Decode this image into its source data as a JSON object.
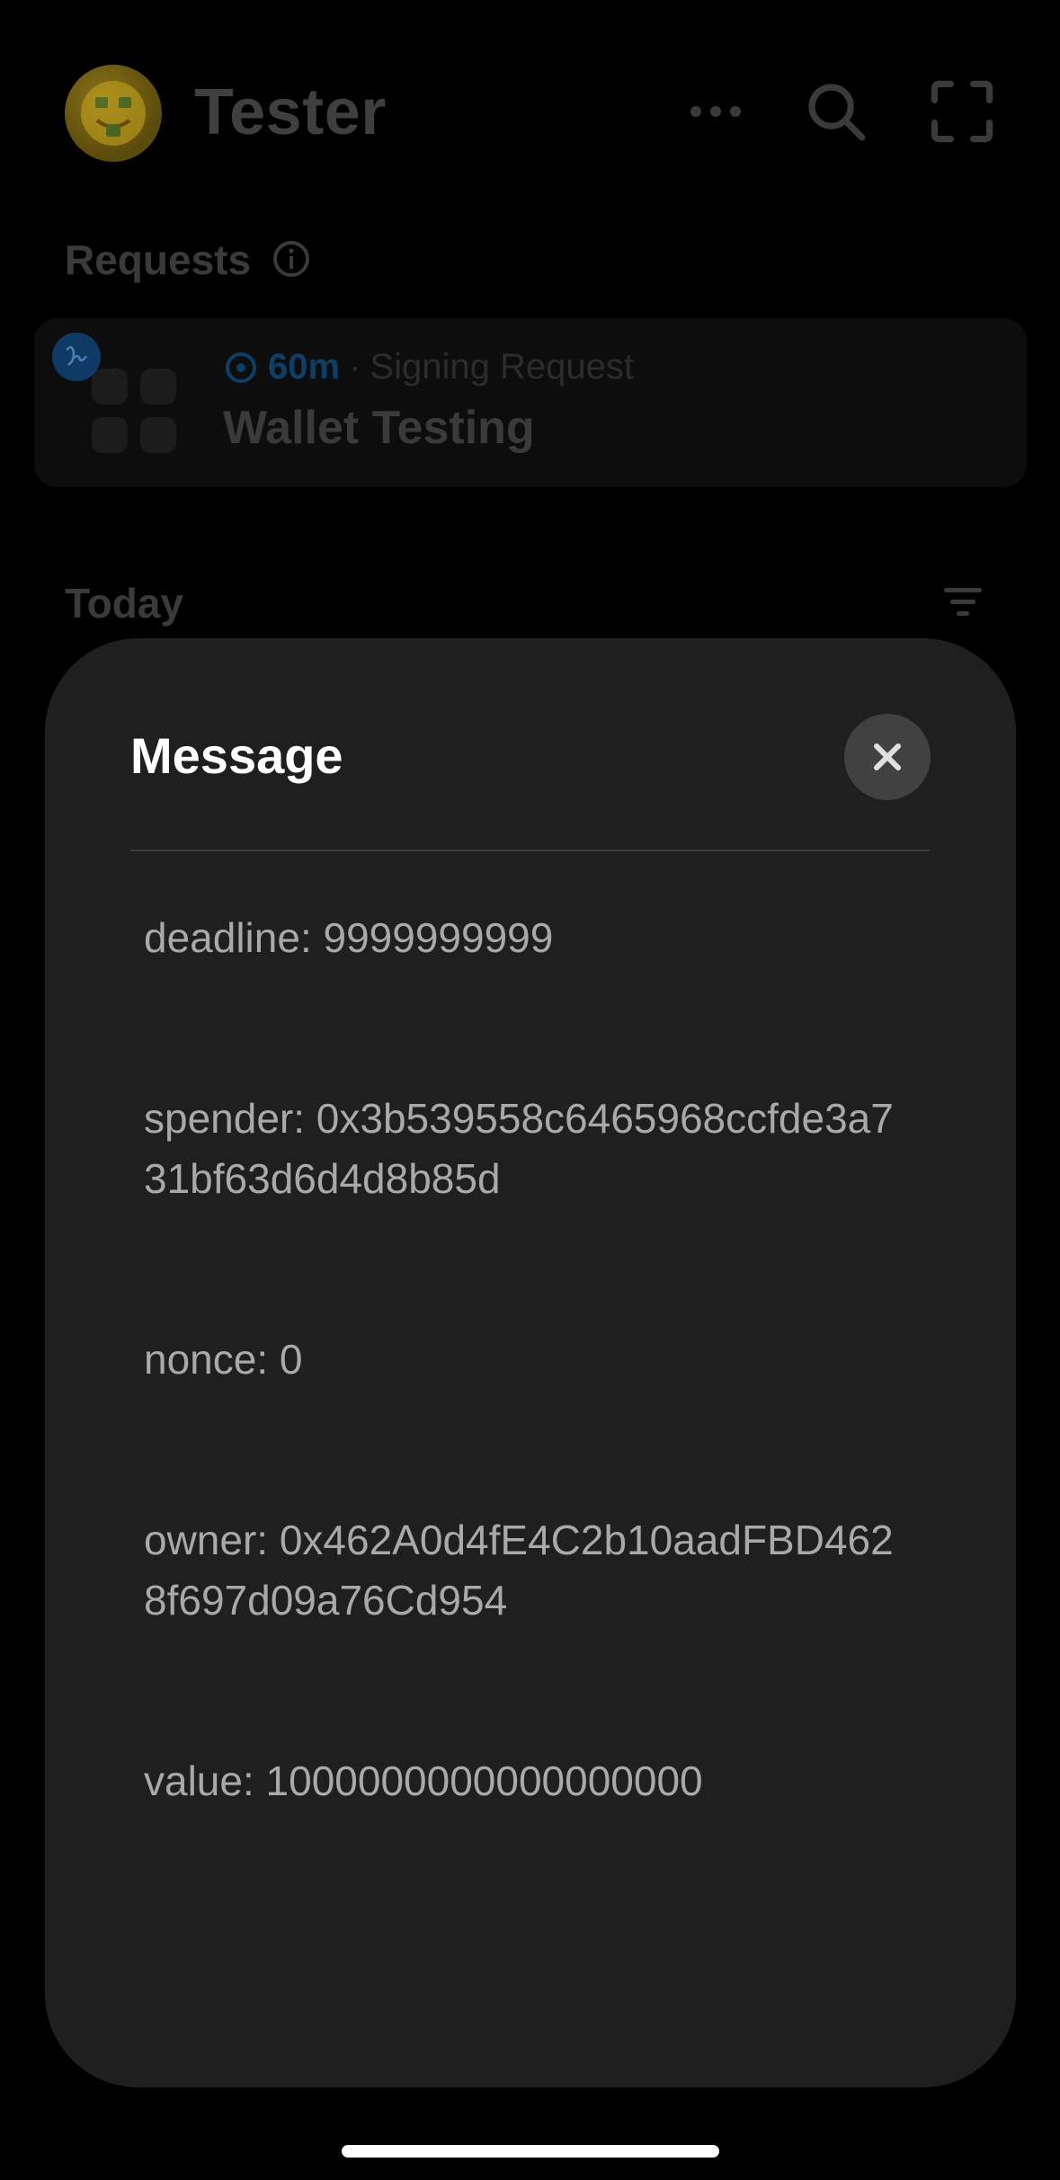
{
  "header": {
    "app_title": "Tester",
    "avatar_icon": "money-mouth-face-icon",
    "more_icon": "ellipsis-icon",
    "search_icon": "search-icon",
    "scan_icon": "scan-icon"
  },
  "requests": {
    "label": "Requests",
    "info_icon": "info-icon",
    "card": {
      "time": "60m",
      "separator": " · ",
      "type": "Signing Request",
      "title": "Wallet Testing"
    }
  },
  "today": {
    "label": "Today",
    "filter_icon": "filter-icon"
  },
  "message_sheet": {
    "title": "Message",
    "close_icon": "close-icon",
    "fields": [
      "deadline: 9999999999",
      "spender: 0x3b539558c6465968ccfde3a731bf63d6d4d8b85d",
      "nonce: 0",
      "owner: 0x462A0d4fE4C2b10aadFBD4628f697d09a76Cd954",
      "value: 1000000000000000000"
    ]
  },
  "colors": {
    "background": "#000000",
    "sheet": "#1f1f1f",
    "close_button": "#414141",
    "accent": "#0d3e66",
    "field_text": "#a9a9a9"
  }
}
